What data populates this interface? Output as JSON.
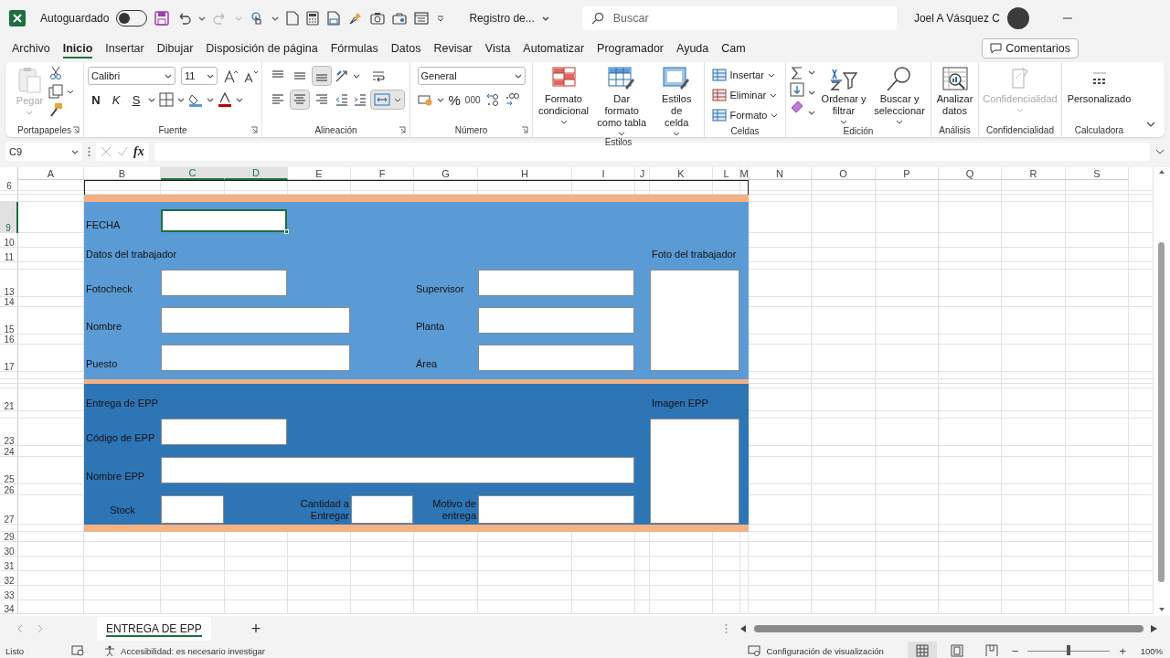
{
  "title_bar": {
    "autosave_label": "Autoguardado",
    "autosave_on": false,
    "file_name": "Registro de...",
    "search_placeholder": "Buscar",
    "user": "Joel A Vásquez C"
  },
  "menu_tabs": [
    {
      "label": "Archivo",
      "selected": false
    },
    {
      "label": "Inicio",
      "selected": true
    },
    {
      "label": "Insertar",
      "selected": false
    },
    {
      "label": "Dibujar",
      "selected": false
    },
    {
      "label": "Disposición de página",
      "selected": false
    },
    {
      "label": "Fórmulas",
      "selected": false
    },
    {
      "label": "Datos",
      "selected": false
    },
    {
      "label": "Revisar",
      "selected": false
    },
    {
      "label": "Vista",
      "selected": false
    },
    {
      "label": "Automatizar",
      "selected": false
    },
    {
      "label": "Programador",
      "selected": false
    },
    {
      "label": "Ayuda",
      "selected": false
    },
    {
      "label": "Cam",
      "selected": false
    }
  ],
  "comments_button": "Comentarios",
  "ribbon": [
    {
      "kind": "clipboard",
      "title": "Portapapeles",
      "paste": {
        "label": "Pegar",
        "disabled": true
      }
    },
    {
      "kind": "font",
      "title": "Fuente",
      "font": "Calibri",
      "size": "11",
      "bold": "N",
      "italic": "K",
      "underline": "S"
    },
    {
      "kind": "align",
      "title": "Alineación",
      "vertical": [
        {
          "selected": false
        },
        {
          "selected": false
        },
        {
          "selected": true
        }
      ],
      "horizontal": [
        {
          "selected": false
        },
        {
          "selected": true
        },
        {
          "selected": false
        }
      ],
      "merged": true
    },
    {
      "kind": "number",
      "title": "Número",
      "format": "General",
      "percent": "%",
      "thousands": "000"
    },
    {
      "kind": "large",
      "title": "Estilos",
      "buttons": [
        {
          "label": "Formato\ncondicional",
          "dropdown": true,
          "disabled": false
        },
        {
          "label": "Dar formato\ncomo tabla",
          "dropdown": true,
          "disabled": false
        },
        {
          "label": "Estilos de\ncelda",
          "dropdown": true,
          "disabled": false
        }
      ]
    },
    {
      "kind": "cells",
      "title": "Celdas",
      "buttons": [
        "Insertar",
        "Eliminar",
        "Formato"
      ]
    },
    {
      "kind": "editing",
      "title": "Edición",
      "buttons": [
        {
          "label": "Ordenar y\nfiltrar",
          "dropdown": true,
          "disabled": false
        },
        {
          "label": "Buscar y\nseleccionar",
          "dropdown": true,
          "disabled": false
        }
      ]
    },
    {
      "kind": "large",
      "title": "Análisis",
      "buttons": [
        {
          "label": "Analizar\ndatos",
          "dropdown": false,
          "disabled": false
        }
      ]
    },
    {
      "kind": "large",
      "title": "Confidencialidad",
      "buttons": [
        {
          "label": "Confidencialidad",
          "dropdown": true,
          "disabled": true
        }
      ]
    },
    {
      "kind": "large",
      "title": "Calculadora",
      "buttons": [
        {
          "label": "Personalizado",
          "dropdown": false,
          "disabled": false
        }
      ]
    }
  ],
  "formula_bar": {
    "name_box": "C9",
    "fx": "fx"
  },
  "sheet": {
    "columns": [
      {
        "label": "A",
        "selected": false
      },
      {
        "label": "B",
        "selected": false
      },
      {
        "label": "C",
        "selected": true
      },
      {
        "label": "D",
        "selected": true
      },
      {
        "label": "E",
        "selected": false
      },
      {
        "label": "F",
        "selected": false
      },
      {
        "label": "G",
        "selected": false
      },
      {
        "label": "H",
        "selected": false
      },
      {
        "label": "I",
        "selected": false
      },
      {
        "label": "J",
        "selected": false
      },
      {
        "label": "K",
        "selected": false
      },
      {
        "label": "L",
        "selected": false
      },
      {
        "label": "M",
        "selected": false
      },
      {
        "label": "N",
        "selected": false
      },
      {
        "label": "O",
        "selected": false
      },
      {
        "label": "P",
        "selected": false
      },
      {
        "label": "Q",
        "selected": false
      },
      {
        "label": "R",
        "selected": false
      },
      {
        "label": "S",
        "selected": false
      }
    ],
    "rows": [
      {
        "label": "6",
        "selected": false
      },
      {
        "label": "9",
        "selected": true
      },
      {
        "label": "10",
        "selected": false
      },
      {
        "label": "11",
        "selected": false
      },
      {
        "label": "13",
        "selected": false
      },
      {
        "label": "14",
        "selected": false
      },
      {
        "label": "15",
        "selected": false
      },
      {
        "label": "16",
        "selected": false
      },
      {
        "label": "17",
        "selected": false
      },
      {
        "label": "21",
        "selected": false
      },
      {
        "label": "23",
        "selected": false
      },
      {
        "label": "24",
        "selected": false
      },
      {
        "label": "25",
        "selected": false
      },
      {
        "label": "26",
        "selected": false
      },
      {
        "label": "27",
        "selected": false
      },
      {
        "label": "29",
        "selected": false
      },
      {
        "label": "30",
        "selected": false
      },
      {
        "label": "31",
        "selected": false
      },
      {
        "label": "32",
        "selected": false
      },
      {
        "label": "33",
        "selected": false
      },
      {
        "label": "34",
        "selected": false
      }
    ]
  },
  "form": {
    "date": {
      "label": "FECHA",
      "selected": true
    },
    "worker": {
      "title": "Datos del trabajador",
      "photo_label": "Foto del trabajador",
      "fields": [
        {
          "label": "Fotocheck",
          "selected": false
        },
        {
          "label": "Supervisor",
          "selected": false
        },
        {
          "label": "Nombre",
          "selected": false
        },
        {
          "label": "Planta",
          "selected": false
        },
        {
          "label": "Puesto",
          "selected": false
        },
        {
          "label": "Área",
          "selected": false
        }
      ]
    },
    "delivery": {
      "title": "Entrega de EPP",
      "image_label": "Imagen EPP",
      "fields": [
        {
          "label": "Código de EPP",
          "selected": false
        },
        {
          "label": "Nombre EPP",
          "selected": false
        },
        {
          "label": "Stock",
          "selected": false
        },
        {
          "label": "Cantidad a\nEntregar",
          "selected": false
        },
        {
          "label": "Motivo de\nentrega",
          "selected": false
        }
      ]
    }
  },
  "sheet_tabs": {
    "tabs": [
      {
        "label": "ENTREGA DE EPP",
        "selected": true
      }
    ],
    "add": "+"
  },
  "status_bar": {
    "ready": "Listo",
    "accessibility": "Accesibilidad: es necesario investigar",
    "display_settings": "Configuración de visualización",
    "views": [
      {
        "selected": true
      },
      {
        "selected": false
      },
      {
        "selected": false
      }
    ],
    "zoom": {
      "minus": "−",
      "plus": "+",
      "level": 0.5,
      "label": "100%"
    }
  }
}
